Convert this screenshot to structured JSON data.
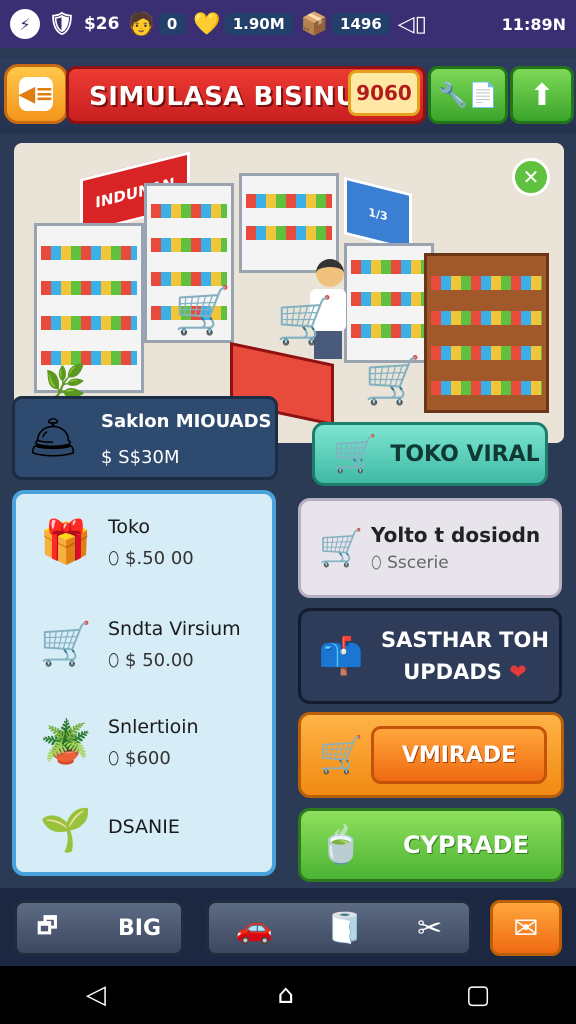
{
  "status_bar": {
    "left_text": "$26",
    "pill_1": "0",
    "pill_2": "1.90M",
    "pill_3": "1496",
    "time": "11:89N"
  },
  "header": {
    "title": "SIMULASA BISINUIS",
    "coin_badge": "9060"
  },
  "scene": {
    "store_sign": "INDUNAN",
    "blue_sign": "1/3"
  },
  "balance": {
    "title": "Saklon MIOUADS",
    "value": "$ S$30M"
  },
  "items": [
    {
      "name": "Toko",
      "price": "$.50 00",
      "icon": "gift-box-icon"
    },
    {
      "name": "Sndta Virsium",
      "price": "$ 50.00",
      "icon": "cart-icon"
    },
    {
      "name": "Snlertioin",
      "price": "$600",
      "icon": "plant-icon"
    },
    {
      "name": "DSANIE",
      "price": "",
      "icon": "potted-plant-icon"
    }
  ],
  "actions": {
    "viral": "TOKO VIRAL",
    "upload_title": "Yolto t dosiodn",
    "upload_sub": "Sscerie",
    "update_line1": "SASTHAR TOH",
    "update_line2": "UPDADS",
    "upgrade": "VMIRADE",
    "cyprade": "CYPRADE"
  },
  "bottom": {
    "big": "BIG"
  },
  "colors": {
    "header_red": "#d82424",
    "accent_green": "#4cb334",
    "accent_orange": "#f18a12",
    "panel_blue": "#4aa2dc"
  }
}
